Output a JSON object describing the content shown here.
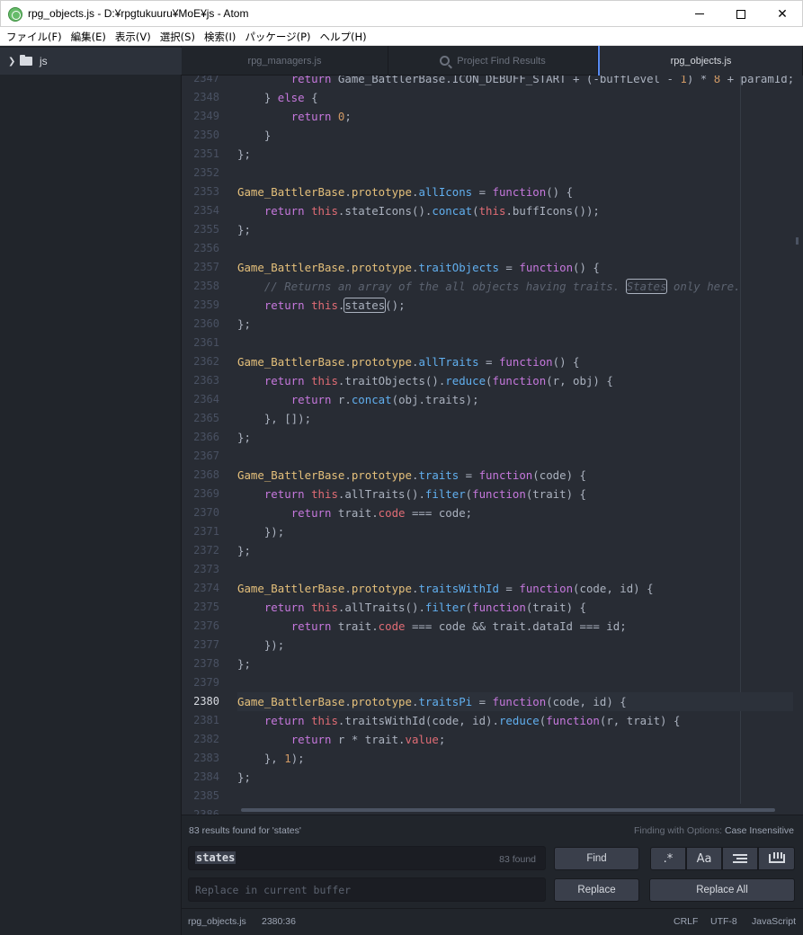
{
  "window": {
    "title": "rpg_objects.js - D:¥rpgtukuuru¥MoE¥js - Atom",
    "controls": {
      "minimize": "",
      "maximize": "",
      "close": "✕"
    }
  },
  "menu": [
    "ファイル(F)",
    "編集(E)",
    "表示(V)",
    "選択(S)",
    "検索(I)",
    "パッケージ(P)",
    "ヘルプ(H)"
  ],
  "tree": {
    "root_folder": "js"
  },
  "tabs": [
    {
      "label": "rpg_managers.js",
      "active": false
    },
    {
      "label": "Project Find Results",
      "active": false
    },
    {
      "label": "rpg_objects.js",
      "active": true
    }
  ],
  "editor": {
    "current_line": "2380",
    "lines": [
      {
        "n": "2347",
        "segs": [
          [
            "        ",
            ""
          ],
          [
            "return",
            "k"
          ],
          [
            " Game_BattlerBase.ICON_DEBUFF_START + (-buffLevel - ",
            ""
          ],
          [
            "1",
            "n"
          ],
          [
            ") * ",
            ""
          ],
          [
            "8",
            "n"
          ],
          [
            " + paramId;",
            ""
          ]
        ]
      },
      {
        "n": "2348",
        "segs": [
          [
            "    } ",
            ""
          ],
          [
            "else",
            "k"
          ],
          [
            " {",
            ""
          ]
        ]
      },
      {
        "n": "2349",
        "segs": [
          [
            "        ",
            ""
          ],
          [
            "return",
            "k"
          ],
          [
            " ",
            ""
          ],
          [
            "0",
            "n"
          ],
          [
            ";",
            ""
          ]
        ]
      },
      {
        "n": "2350",
        "segs": [
          [
            "    }",
            ""
          ]
        ]
      },
      {
        "n": "2351",
        "segs": [
          [
            "};",
            ""
          ]
        ]
      },
      {
        "n": "2352",
        "segs": []
      },
      {
        "n": "2353",
        "segs": [
          [
            "Game_BattlerBase",
            "t"
          ],
          [
            ".",
            ""
          ],
          [
            "prototype",
            "t"
          ],
          [
            ".",
            ""
          ],
          [
            "allIcons",
            "f"
          ],
          [
            " = ",
            ""
          ],
          [
            "function",
            "k"
          ],
          [
            "() {",
            ""
          ]
        ]
      },
      {
        "n": "2354",
        "segs": [
          [
            "    ",
            ""
          ],
          [
            "return",
            "k"
          ],
          [
            " ",
            ""
          ],
          [
            "this",
            "th"
          ],
          [
            ".stateIcons().",
            ""
          ],
          [
            "concat",
            "f"
          ],
          [
            "(",
            ""
          ],
          [
            "this",
            "th"
          ],
          [
            ".buffIcons());",
            ""
          ]
        ]
      },
      {
        "n": "2355",
        "segs": [
          [
            "};",
            ""
          ]
        ]
      },
      {
        "n": "2356",
        "segs": []
      },
      {
        "n": "2357",
        "segs": [
          [
            "Game_BattlerBase",
            "t"
          ],
          [
            ".",
            ""
          ],
          [
            "prototype",
            "t"
          ],
          [
            ".",
            ""
          ],
          [
            "traitObjects",
            "f"
          ],
          [
            " = ",
            ""
          ],
          [
            "function",
            "k"
          ],
          [
            "() {",
            ""
          ]
        ]
      },
      {
        "n": "2358",
        "segs": [
          [
            "    ",
            ""
          ],
          [
            "// Returns an array of the all objects having traits. ",
            "c"
          ],
          [
            "States",
            "c hl"
          ],
          [
            " only here.",
            "c"
          ]
        ]
      },
      {
        "n": "2359",
        "segs": [
          [
            "    ",
            ""
          ],
          [
            "return",
            "k"
          ],
          [
            " ",
            ""
          ],
          [
            "this",
            "th"
          ],
          [
            ".",
            ""
          ],
          [
            "states",
            "hl"
          ],
          [
            "();",
            ""
          ]
        ]
      },
      {
        "n": "2360",
        "segs": [
          [
            "};",
            ""
          ]
        ]
      },
      {
        "n": "2361",
        "segs": []
      },
      {
        "n": "2362",
        "segs": [
          [
            "Game_BattlerBase",
            "t"
          ],
          [
            ".",
            ""
          ],
          [
            "prototype",
            "t"
          ],
          [
            ".",
            ""
          ],
          [
            "allTraits",
            "f"
          ],
          [
            " = ",
            ""
          ],
          [
            "function",
            "k"
          ],
          [
            "() {",
            ""
          ]
        ]
      },
      {
        "n": "2363",
        "segs": [
          [
            "    ",
            ""
          ],
          [
            "return",
            "k"
          ],
          [
            " ",
            ""
          ],
          [
            "this",
            "th"
          ],
          [
            ".traitObjects().",
            ""
          ],
          [
            "reduce",
            "f"
          ],
          [
            "(",
            ""
          ],
          [
            "function",
            "k"
          ],
          [
            "(r, obj) {",
            ""
          ]
        ]
      },
      {
        "n": "2364",
        "segs": [
          [
            "        ",
            ""
          ],
          [
            "return",
            "k"
          ],
          [
            " r.",
            ""
          ],
          [
            "concat",
            "f"
          ],
          [
            "(obj.traits);",
            ""
          ]
        ]
      },
      {
        "n": "2365",
        "segs": [
          [
            "    }, []);",
            ""
          ]
        ]
      },
      {
        "n": "2366",
        "segs": [
          [
            "};",
            ""
          ]
        ]
      },
      {
        "n": "2367",
        "segs": []
      },
      {
        "n": "2368",
        "segs": [
          [
            "Game_BattlerBase",
            "t"
          ],
          [
            ".",
            ""
          ],
          [
            "prototype",
            "t"
          ],
          [
            ".",
            ""
          ],
          [
            "traits",
            "f"
          ],
          [
            " = ",
            ""
          ],
          [
            "function",
            "k"
          ],
          [
            "(code) {",
            ""
          ]
        ]
      },
      {
        "n": "2369",
        "segs": [
          [
            "    ",
            ""
          ],
          [
            "return",
            "k"
          ],
          [
            " ",
            ""
          ],
          [
            "this",
            "th"
          ],
          [
            ".allTraits().",
            ""
          ],
          [
            "filter",
            "f"
          ],
          [
            "(",
            ""
          ],
          [
            "function",
            "k"
          ],
          [
            "(trait) {",
            ""
          ]
        ]
      },
      {
        "n": "2370",
        "segs": [
          [
            "        ",
            ""
          ],
          [
            "return",
            "k"
          ],
          [
            " trait.",
            ""
          ],
          [
            "code",
            "pr"
          ],
          [
            " === code;",
            ""
          ]
        ]
      },
      {
        "n": "2371",
        "segs": [
          [
            "    });",
            ""
          ]
        ]
      },
      {
        "n": "2372",
        "segs": [
          [
            "};",
            ""
          ]
        ]
      },
      {
        "n": "2373",
        "segs": []
      },
      {
        "n": "2374",
        "segs": [
          [
            "Game_BattlerBase",
            "t"
          ],
          [
            ".",
            ""
          ],
          [
            "prototype",
            "t"
          ],
          [
            ".",
            ""
          ],
          [
            "traitsWithId",
            "f"
          ],
          [
            " = ",
            ""
          ],
          [
            "function",
            "k"
          ],
          [
            "(code, id) {",
            ""
          ]
        ]
      },
      {
        "n": "2375",
        "segs": [
          [
            "    ",
            ""
          ],
          [
            "return",
            "k"
          ],
          [
            " ",
            ""
          ],
          [
            "this",
            "th"
          ],
          [
            ".allTraits().",
            ""
          ],
          [
            "filter",
            "f"
          ],
          [
            "(",
            ""
          ],
          [
            "function",
            "k"
          ],
          [
            "(trait) {",
            ""
          ]
        ]
      },
      {
        "n": "2376",
        "segs": [
          [
            "        ",
            ""
          ],
          [
            "return",
            "k"
          ],
          [
            " trait.",
            ""
          ],
          [
            "code",
            "pr"
          ],
          [
            " === code && trait.dataId === id;",
            ""
          ]
        ]
      },
      {
        "n": "2377",
        "segs": [
          [
            "    });",
            ""
          ]
        ]
      },
      {
        "n": "2378",
        "segs": [
          [
            "};",
            ""
          ]
        ]
      },
      {
        "n": "2379",
        "segs": []
      },
      {
        "n": "2380",
        "segs": [
          [
            "Game_BattlerBase",
            "t"
          ],
          [
            ".",
            ""
          ],
          [
            "prototype",
            "t"
          ],
          [
            ".",
            ""
          ],
          [
            "traitsPi",
            "f"
          ],
          [
            " = ",
            ""
          ],
          [
            "function",
            "k"
          ],
          [
            "(code, id) {",
            ""
          ]
        ]
      },
      {
        "n": "2381",
        "segs": [
          [
            "    ",
            ""
          ],
          [
            "return",
            "k"
          ],
          [
            " ",
            ""
          ],
          [
            "this",
            "th"
          ],
          [
            ".traitsWithId(code, id).",
            ""
          ],
          [
            "reduce",
            "f"
          ],
          [
            "(",
            ""
          ],
          [
            "function",
            "k"
          ],
          [
            "(r, trait) {",
            ""
          ]
        ]
      },
      {
        "n": "2382",
        "segs": [
          [
            "        ",
            ""
          ],
          [
            "return",
            "k"
          ],
          [
            " r * trait.",
            ""
          ],
          [
            "value",
            "pr"
          ],
          [
            ";",
            ""
          ]
        ]
      },
      {
        "n": "2383",
        "segs": [
          [
            "    }, ",
            ""
          ],
          [
            "1",
            "n"
          ],
          [
            ");",
            ""
          ]
        ]
      },
      {
        "n": "2384",
        "segs": [
          [
            "};",
            ""
          ]
        ]
      },
      {
        "n": "2385",
        "segs": []
      },
      {
        "n": "2386",
        "segs": []
      }
    ]
  },
  "find": {
    "results_text": "83 results found for 'states'",
    "options_label": "Finding with Options:",
    "options_value": "Case Insensitive",
    "query": "states",
    "found_count": "83 found",
    "replace_placeholder": "Replace in current buffer",
    "find_label": "Find",
    "replace_label": "Replace",
    "replace_all_label": "Replace All",
    "regex_toggle": ".*",
    "case_toggle": "Aa"
  },
  "status": {
    "file": "rpg_objects.js",
    "cursor": "2380:36",
    "line_ending": "CRLF",
    "encoding": "UTF-8",
    "grammar": "JavaScript"
  }
}
